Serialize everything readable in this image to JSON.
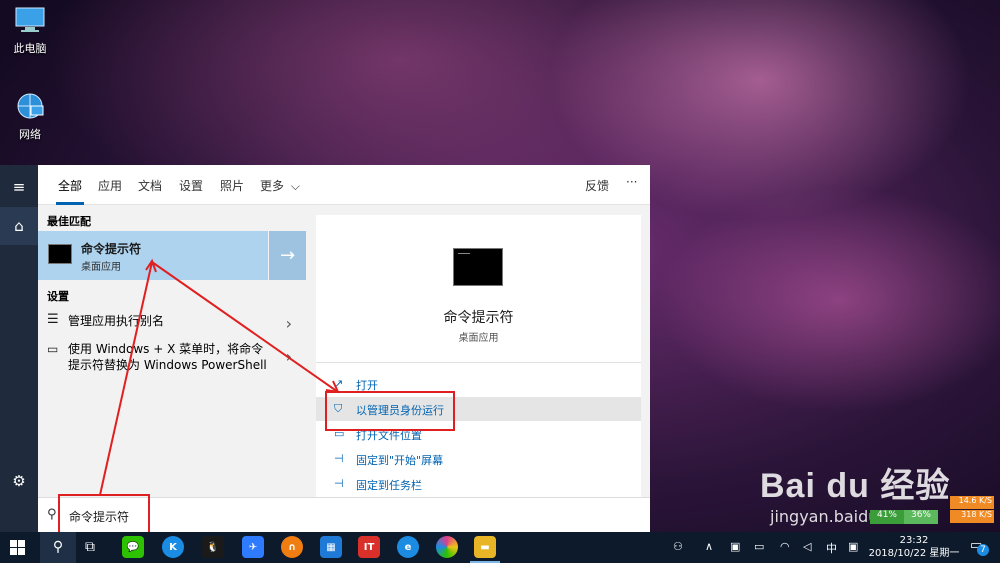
{
  "desktop": {
    "icons": [
      {
        "label": "此电脑",
        "icon": "computer-icon"
      },
      {
        "label": "网络",
        "icon": "network-icon"
      }
    ]
  },
  "search_panel": {
    "tabs": [
      "全部",
      "应用",
      "文档",
      "设置",
      "照片",
      "更多"
    ],
    "active_tab": "全部",
    "feedback_label": "反馈",
    "more_options_label": "···",
    "best_match": {
      "section_title": "最佳匹配",
      "title": "命令提示符",
      "subtitle": "桌面应用"
    },
    "settings": {
      "section_title": "设置",
      "items": [
        {
          "label": "管理应用执行别名",
          "icon": "list-icon"
        },
        {
          "label_line1": "使用 Windows + X 菜单时，将命令",
          "label_line2": "提示符替换为 Windows PowerShell",
          "icon": "laptop-icon"
        }
      ]
    },
    "preview": {
      "title": "命令提示符",
      "subtitle": "桌面应用",
      "actions": [
        {
          "label": "打开",
          "icon": "open-icon"
        },
        {
          "label": "以管理员身份运行",
          "icon": "shield-icon"
        },
        {
          "label": "打开文件位置",
          "icon": "folder-icon"
        },
        {
          "label": "固定到\"开始\"屏幕",
          "icon": "pin-icon"
        },
        {
          "label": "固定到任务栏",
          "icon": "pin-icon"
        }
      ]
    },
    "search_box": {
      "value": "命令提示符"
    }
  },
  "taskbar": {
    "apps": [
      {
        "name": "wechat",
        "color": "#2dc100",
        "glyph": "💬"
      },
      {
        "name": "k-app",
        "color": "#1b8ce3",
        "glyph": "K"
      },
      {
        "name": "qq",
        "color": "#1a1a1a",
        "glyph": "🐧"
      },
      {
        "name": "swift-app",
        "color": "#2f7bff",
        "glyph": "✈"
      },
      {
        "name": "orange-app",
        "color": "#f07d12",
        "glyph": "∩"
      },
      {
        "name": "office-app",
        "color": "#1e7ad6",
        "glyph": "▦"
      },
      {
        "name": "it-app",
        "color": "#d9302a",
        "glyph": "IT"
      },
      {
        "name": "edge",
        "color": "#1c8ce3",
        "glyph": "e"
      },
      {
        "name": "color-app",
        "color": "#e23c8a",
        "glyph": "◉"
      },
      {
        "name": "file-explorer",
        "color": "#e8b526",
        "glyph": "▬"
      }
    ],
    "ime_label": "中",
    "clock_time": "23:32",
    "clock_date": "2018/10/22 星期一",
    "notification_count": "7"
  },
  "overlays": {
    "watermark": "Bai du 经验",
    "watermark_url": "jingyan.baidu.com",
    "net_stats": {
      "cpu": "41%",
      "mem": "36%",
      "up": "14.6 K/S",
      "down": "318 K/S"
    }
  },
  "colors": {
    "accent": "#0063b1",
    "highlight": "#aed3ef",
    "annotation": "#e02020"
  }
}
